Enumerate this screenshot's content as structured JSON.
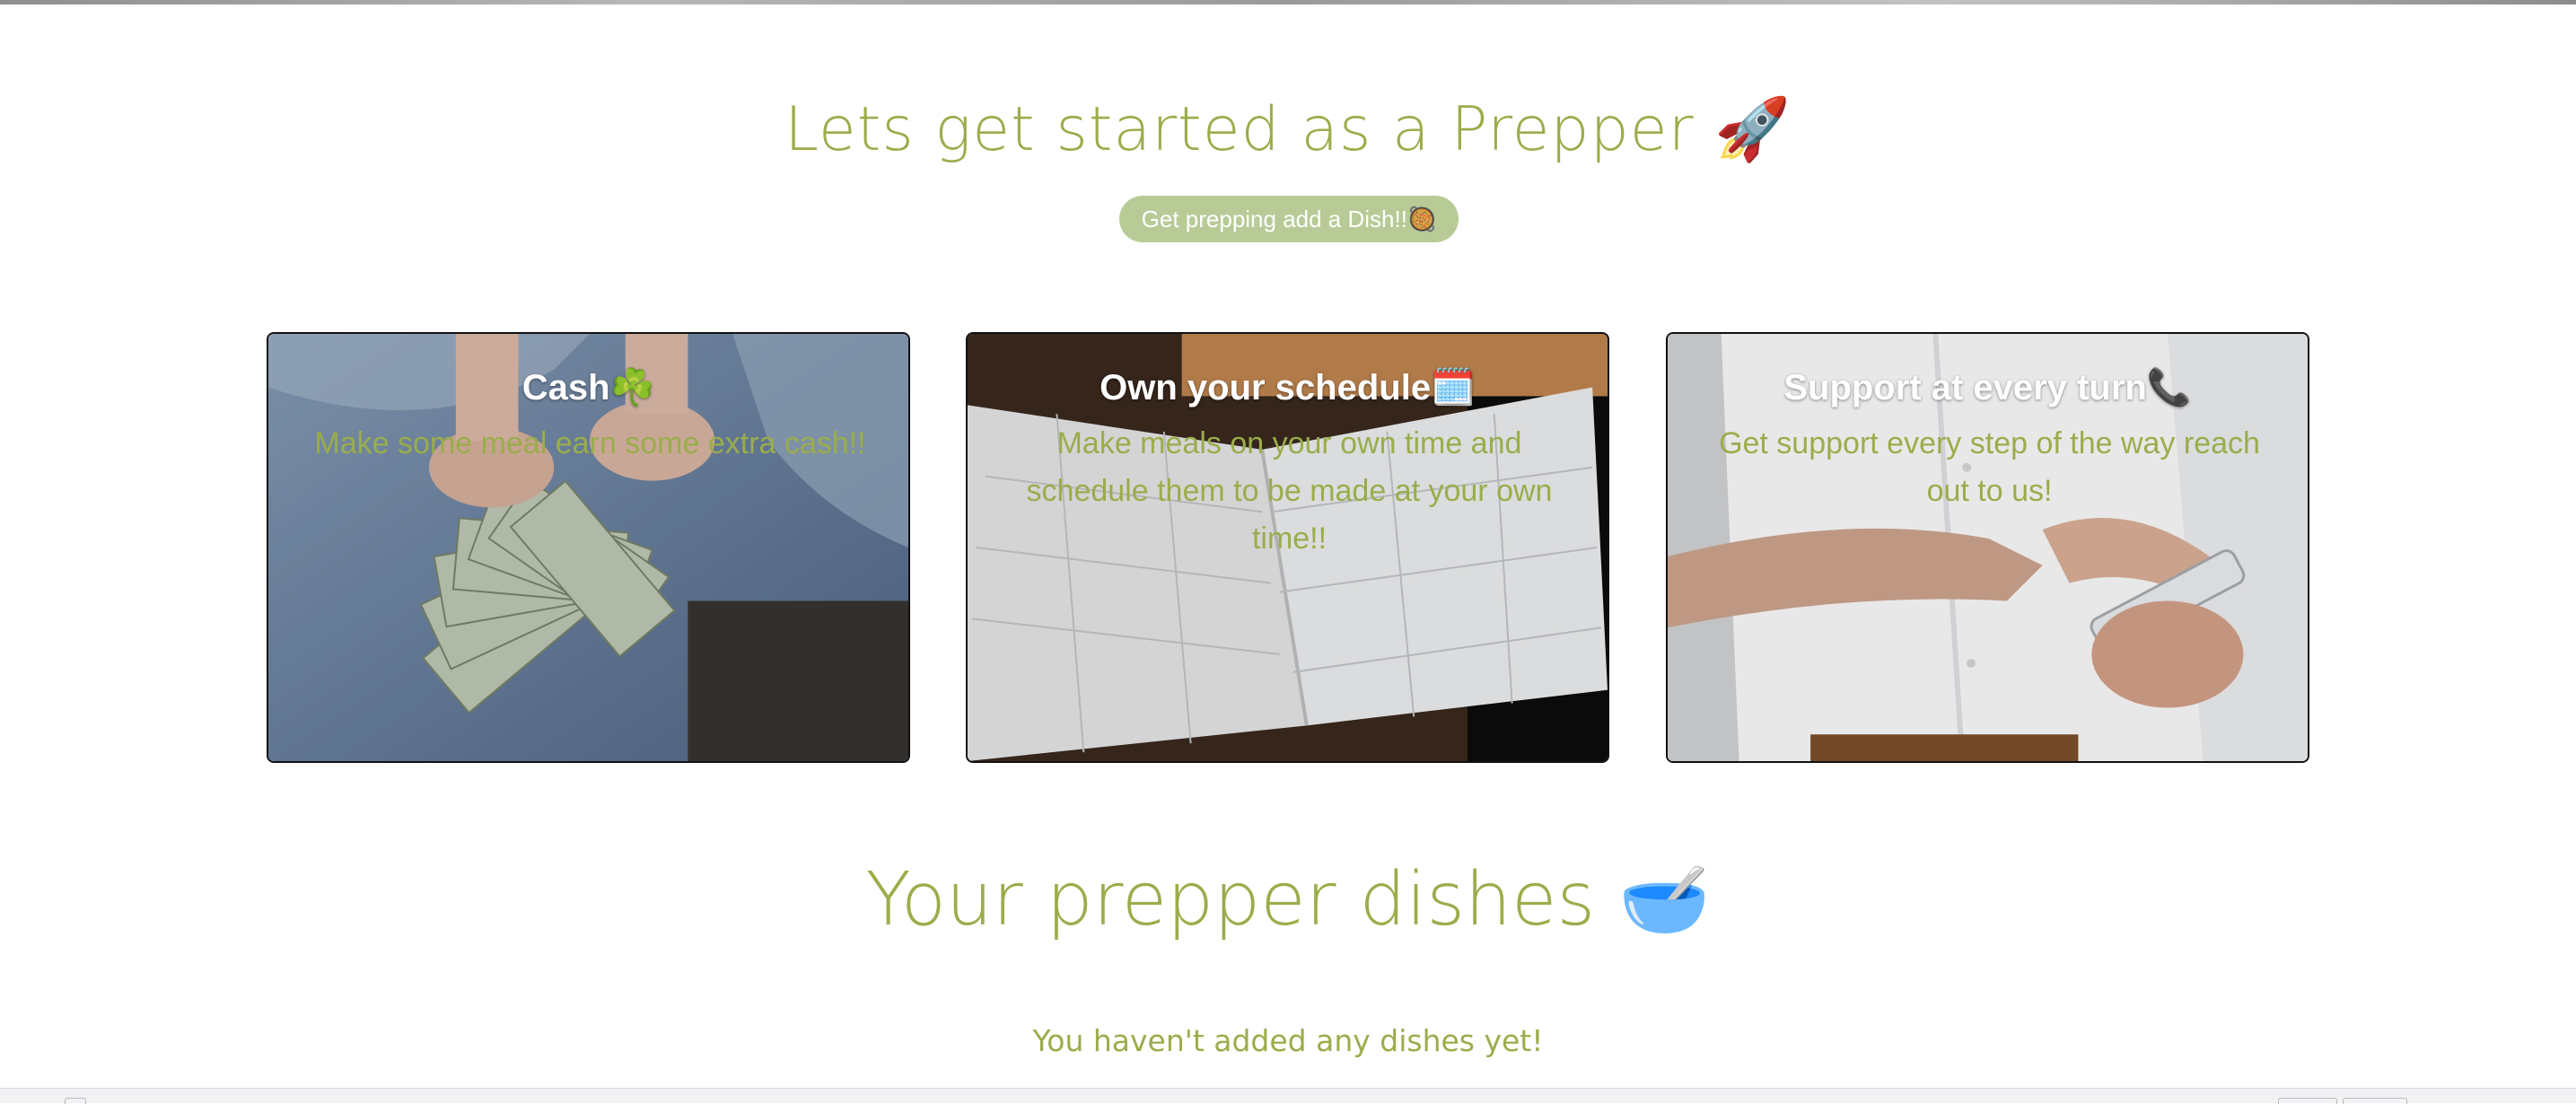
{
  "hero": {
    "title": "Lets get started as a Prepper 🚀",
    "cta_label": "Get prepping add a Dish!!🥘"
  },
  "cards": [
    {
      "title": "Cash☘️",
      "text": "Make some meal earn some extra cash!!"
    },
    {
      "title": "Own your schedule🗓️",
      "text": "Make meals on your own time and schedule them to be made at your own time!!"
    },
    {
      "title": "Support at every turn📞",
      "text": "Get support every step of the way reach out to us!"
    }
  ],
  "dishes": {
    "title": "Your prepper dishes 🥣",
    "empty_message": "You haven't added any dishes yet!"
  },
  "colors": {
    "accent": "#9aad4b",
    "button": "#b8cb97"
  }
}
